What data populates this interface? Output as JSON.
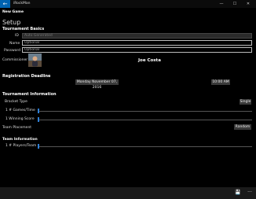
{
  "window": {
    "title": "iRockMan",
    "back_glyph": "←",
    "min_glyph": "—",
    "max_glyph": "☐",
    "close_glyph": "✕"
  },
  "page": {
    "header": "New Game",
    "title": "Setup"
  },
  "basics": {
    "heading": "Tournament Basics",
    "id_label": "ID",
    "id_value": "Auto Generated",
    "name_label": "Name",
    "name_placeholder": "Optional",
    "password_label": "Password",
    "password_placeholder": "Optional",
    "commissioner_label": "Commissioner",
    "commissioner_name": "Joe Costa"
  },
  "deadline": {
    "heading": "Registration Deadline",
    "date": "Monday November 07, 2016",
    "time": "10:00 AM"
  },
  "info": {
    "heading": "Tournament Information",
    "bracket_label": "Bracket Type",
    "bracket_value": "Single",
    "games_label": "1  # Games/Time",
    "games_slider_fraction": 0,
    "winning_label": "1  Winning Score",
    "winning_slider_fraction": 0,
    "placement_label": "Team Placement",
    "placement_value": "Random"
  },
  "team": {
    "heading": "Team Information",
    "players_label": "1  # Players/Team",
    "players_slider_fraction": 0
  },
  "appbar": {
    "save_glyph": "💾",
    "more_glyph": "···"
  },
  "colors": {
    "accent": "#2e7fd6",
    "titlebar_back": "#0063b1"
  }
}
